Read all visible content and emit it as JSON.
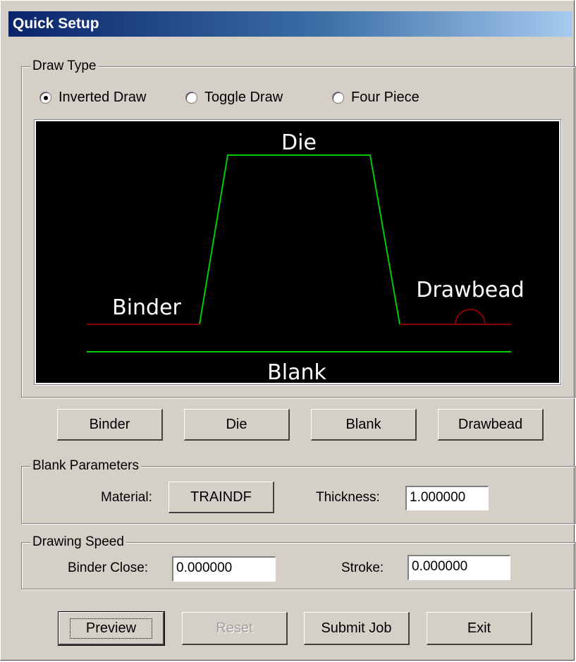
{
  "window": {
    "title": "Quick Setup"
  },
  "draw_type": {
    "legend": "Draw Type",
    "options": [
      {
        "label": "Inverted Draw",
        "selected": true
      },
      {
        "label": "Toggle Draw",
        "selected": false
      },
      {
        "label": "Four Piece",
        "selected": false
      }
    ],
    "diagram": {
      "die_label": "Die",
      "binder_label": "Binder",
      "drawbead_label": "Drawbead",
      "blank_label": "Blank",
      "colors": {
        "background": "#000000",
        "die": "#00cc00",
        "blank": "#00cc00",
        "binder": "#8b0000",
        "drawbead": "#8b0000"
      }
    }
  },
  "tool_buttons": {
    "binder": "Binder",
    "die": "Die",
    "blank": "Blank",
    "drawbead": "Drawbead"
  },
  "blank_parameters": {
    "legend": "Blank Parameters",
    "material_label": "Material:",
    "material_value": "TRAINDF",
    "thickness_label": "Thickness:",
    "thickness_value": "1.000000"
  },
  "drawing_speed": {
    "legend": "Drawing Speed",
    "binder_close_label": "Binder Close:",
    "binder_close_value": "0.000000",
    "stroke_label": "Stroke:",
    "stroke_value": "0.000000"
  },
  "actions": {
    "preview": "Preview",
    "reset": "Reset",
    "submit": "Submit Job",
    "exit": "Exit"
  }
}
